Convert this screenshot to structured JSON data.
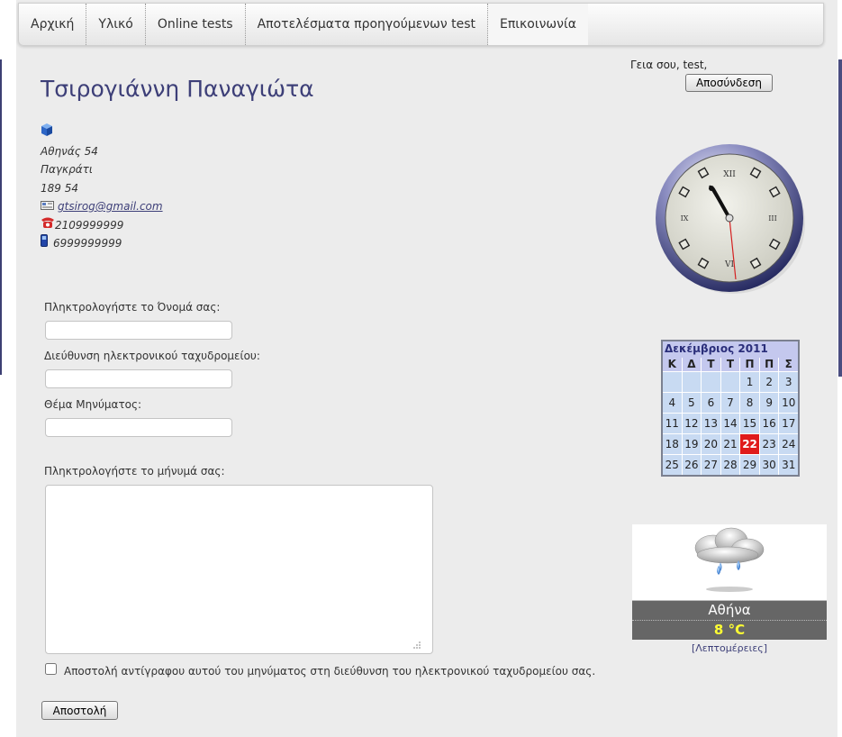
{
  "nav": {
    "items": [
      {
        "label": "Αρχική"
      },
      {
        "label": "Υλικό"
      },
      {
        "label": "Online tests"
      },
      {
        "label": "Αποτελέσματα προηγούμενων test"
      },
      {
        "label": "Επικοινωνία"
      }
    ]
  },
  "user": {
    "greeting": "Γεια σου, test,",
    "logout_label": "Αποσύνδεση"
  },
  "contact": {
    "name": "Τσιρογιάννη Παναγιώτα",
    "street": "Αθηνάς 54",
    "area": "Παγκράτι",
    "postcode": "189 54",
    "email": "gtsirog@gmail.com",
    "phone": "2109999999",
    "mobile": "6999999999"
  },
  "form": {
    "name_label": "Πληκτρολογήστε το Όνομά σας:",
    "email_label": "Διεύθυνση ηλεκτρονικού ταχυδρομείου:",
    "subject_label": "Θέμα Μηνύματος:",
    "message_label": "Πληκτρολογήστε το μήνυμά σας:",
    "copy_label": "Αποστολή αντίγραφου αυτού του μηνύματος στη διεύθυνση του ηλεκτρονικού ταχυδρομείου σας.",
    "send_label": "Αποστολή"
  },
  "calendar": {
    "title": "Δεκέμβριος 2011",
    "weekdays": [
      "Κ",
      "Δ",
      "Τ",
      "Τ",
      "Π",
      "Π",
      "Σ"
    ],
    "leading_blanks": 4,
    "days_in_month": 31,
    "today": 22
  },
  "weather": {
    "city": "Αθήνα",
    "temp": "8 °C",
    "details_label": "[Λεπτομέρειες]"
  },
  "colors": {
    "accent": "#3d3f78",
    "today": "#e01b1b",
    "calendar_cell": "#c8daf2",
    "calendar_header": "#c4c8ee",
    "temp": "#ffff33"
  }
}
